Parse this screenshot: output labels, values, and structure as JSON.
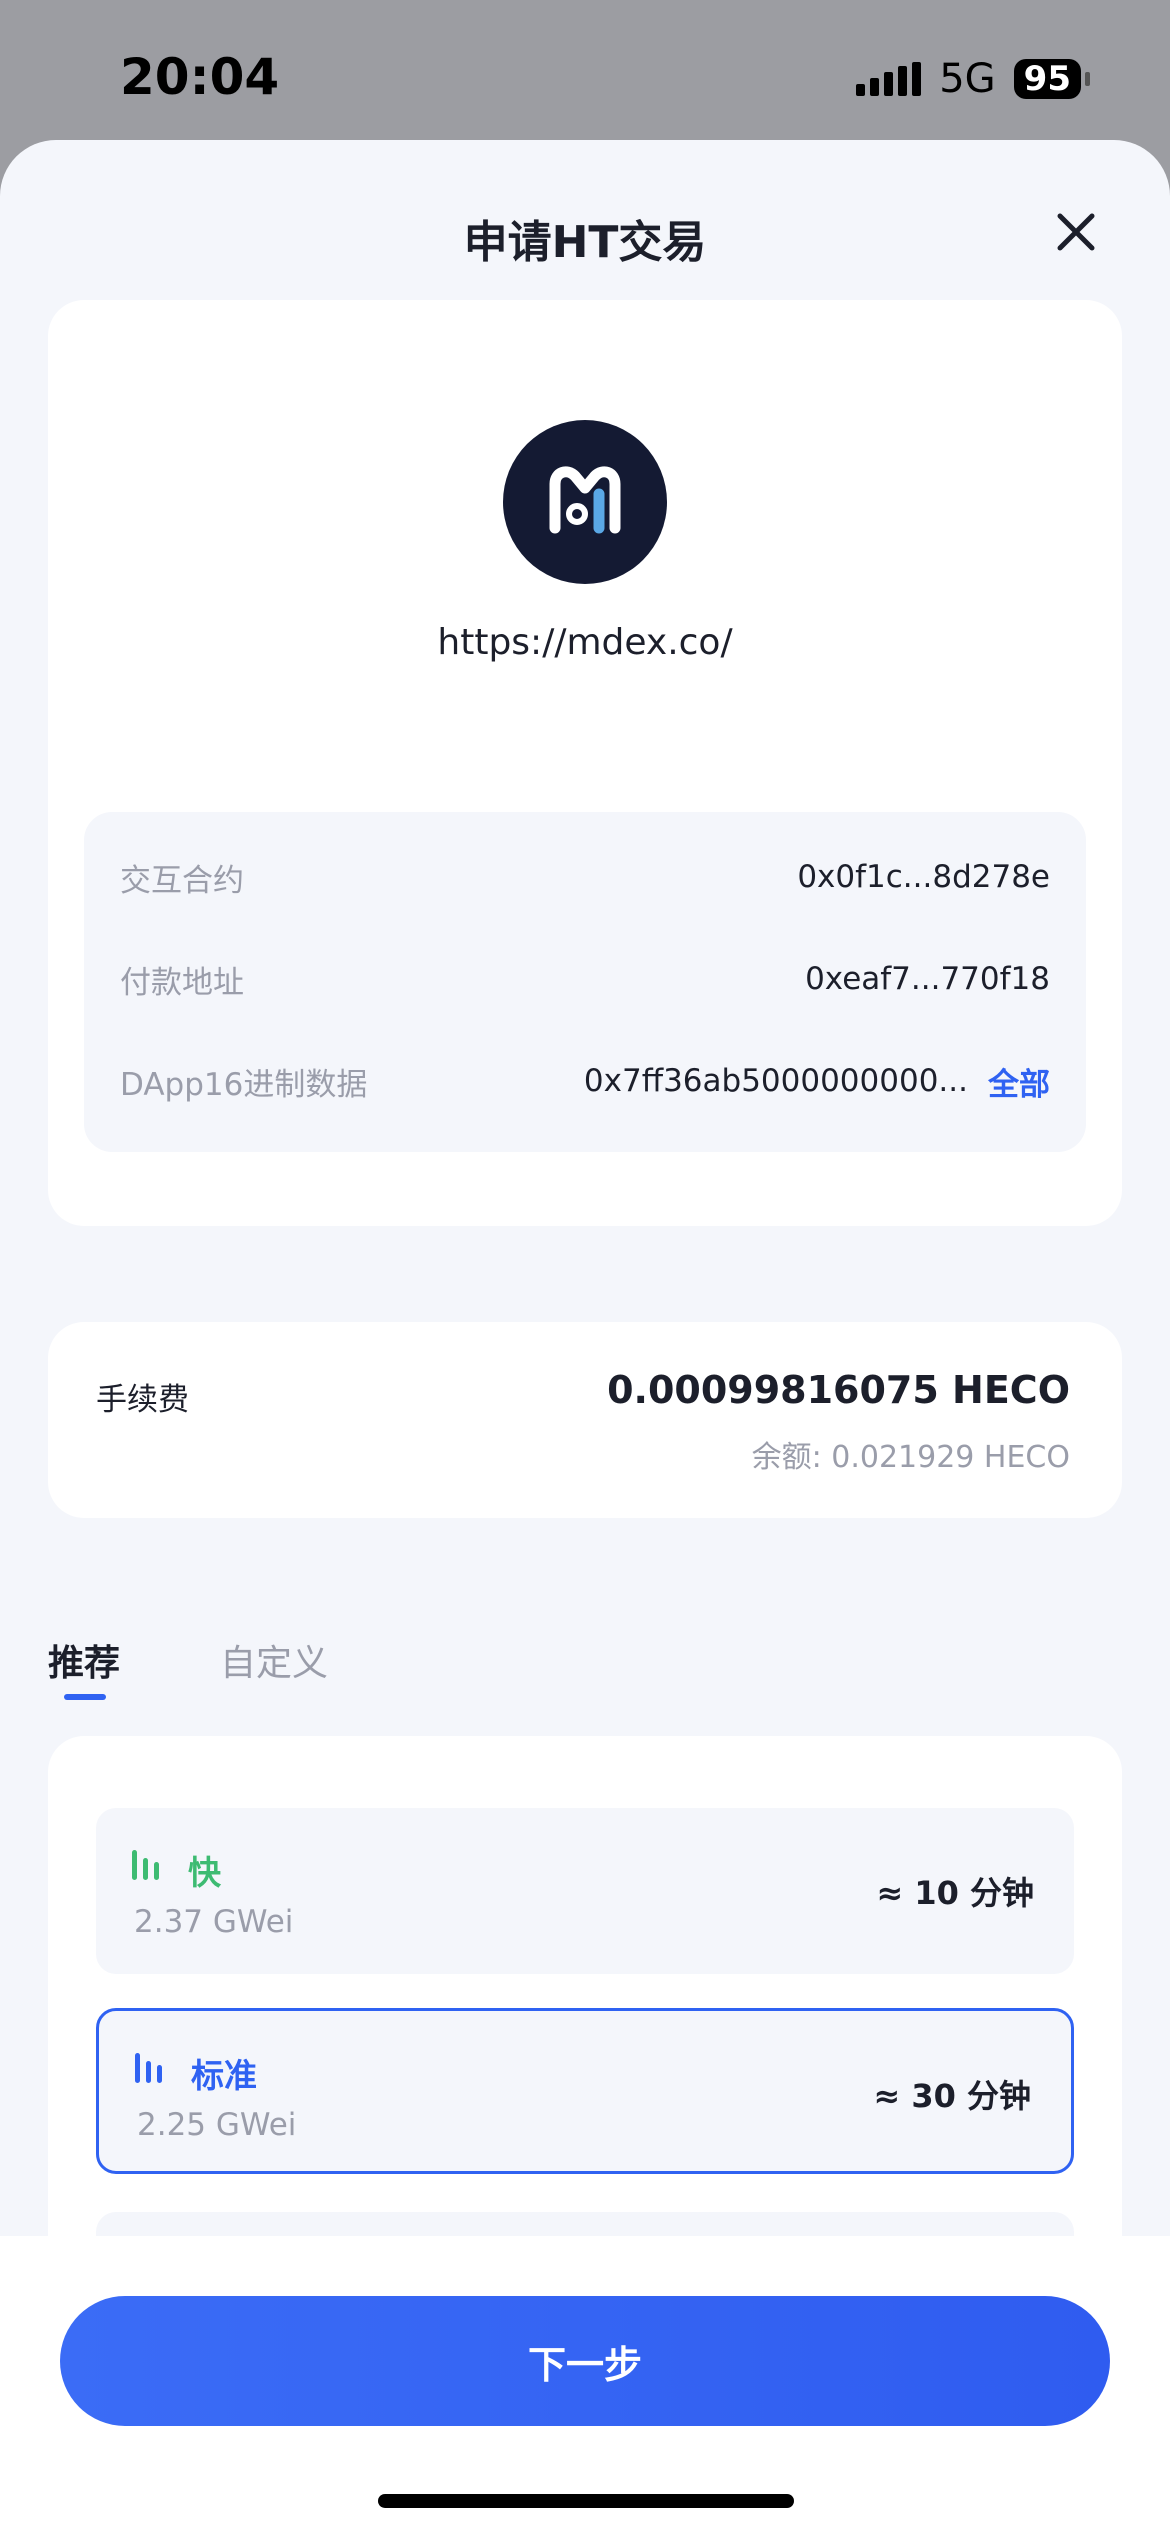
{
  "status_bar": {
    "time": "20:04",
    "network": "5G",
    "battery": "95"
  },
  "sheet": {
    "title": "申请HT交易",
    "close_icon": "close-icon"
  },
  "dapp": {
    "logo_icon": "mdex-logo-icon",
    "url": "https://mdex.co/"
  },
  "info": {
    "rows": [
      {
        "label": "交互合约",
        "value": "0x0f1c...8d278e"
      },
      {
        "label": "付款地址",
        "value": "0xeaf7...770f18"
      },
      {
        "label": "DApp16进制数据",
        "value": "0x7ff36ab5000000000...",
        "link": "全部"
      }
    ]
  },
  "fee": {
    "label": "手续费",
    "amount": "0.00099816075 HECO",
    "balance": "余额: 0.021929 HECO"
  },
  "tabs": [
    {
      "label": "推荐",
      "active": true
    },
    {
      "label": "自定义",
      "active": false
    }
  ],
  "speed_options": [
    {
      "name": "快",
      "gwei": "2.37 GWei",
      "time": "≈ 10 分钟",
      "color": "#3dbb72",
      "selected": false
    },
    {
      "name": "标准",
      "gwei": "2.25 GWei",
      "time": "≈ 30 分钟",
      "color": "#2f62f2",
      "selected": true
    }
  ],
  "footer": {
    "next_label": "下一步"
  },
  "colors": {
    "accent": "#2f62f2",
    "fast": "#3dbb72",
    "muted": "#9a9daa",
    "text": "#1c1f2b"
  }
}
